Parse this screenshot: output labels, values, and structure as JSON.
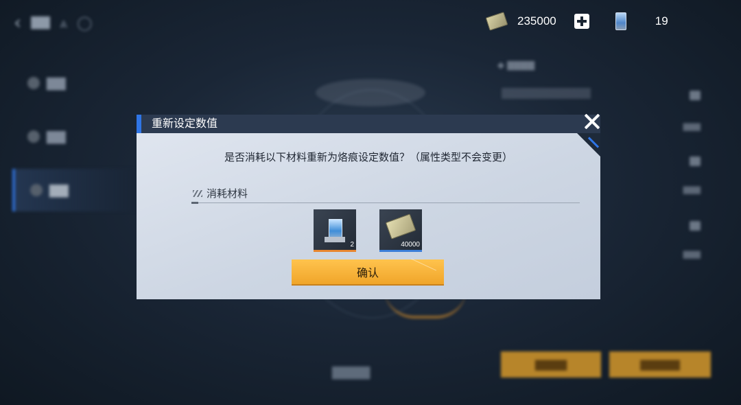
{
  "currency": {
    "money_icon": "cash-icon",
    "money_value": "235000",
    "add_icon": "plus-icon",
    "crystal_icon": "crystal-icon",
    "crystal_count": "19"
  },
  "dialog": {
    "title": "重新设定数值",
    "close_icon": "close-icon",
    "question": "是否消耗以下材料重新为烙痕设定数值？（属性类型不会变更）",
    "materials_label": "消耗材料",
    "materials": [
      {
        "icon": "crystal-item-icon",
        "quantity": "2",
        "rarity_color": "#e8862f"
      },
      {
        "icon": "cash-item-icon",
        "quantity": "40000",
        "rarity_color": "#3b7ed8"
      }
    ],
    "confirm_label": "确认"
  },
  "colors": {
    "accent_blue": "#2f75e6",
    "confirm_orange": "#f7b23b"
  }
}
